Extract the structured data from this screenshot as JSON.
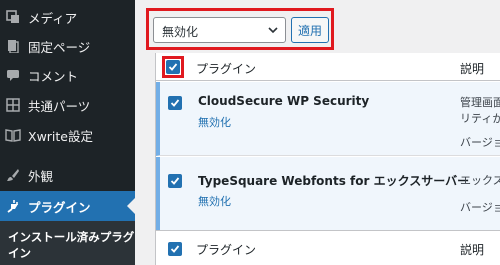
{
  "sidebar": {
    "items": [
      {
        "label": "メディア",
        "icon": "media-icon"
      },
      {
        "label": "固定ページ",
        "icon": "page-icon"
      },
      {
        "label": "コメント",
        "icon": "comment-icon"
      },
      {
        "label": "共通パーツ",
        "icon": "blocks-icon"
      },
      {
        "label": "Xwrite設定",
        "icon": "book-icon"
      },
      {
        "label": "外観",
        "icon": "brush-icon"
      },
      {
        "label": "プラグイン",
        "icon": "plugin-icon"
      }
    ],
    "submenu_label": "インストール済みプラグイン",
    "active_color": "#2271b1"
  },
  "bulk_actions": {
    "selected": "無効化",
    "apply_label": "適用"
  },
  "table": {
    "header": {
      "plugin": "プラグイン",
      "description": "説明"
    },
    "footer": {
      "plugin": "プラグイン",
      "description": "説明"
    },
    "rows": [
      {
        "name": "CloudSecure WP Security",
        "action": "無効化",
        "desc_line1": "管理画面",
        "desc_line2": "リティか",
        "desc_line3": "バージョ"
      },
      {
        "name": "TypeSquare Webfonts for エックスサーバー",
        "action": "無効化",
        "desc_line1": "エックス",
        "desc_line2": "バージョ"
      }
    ]
  },
  "highlight_color": "#e0191f"
}
